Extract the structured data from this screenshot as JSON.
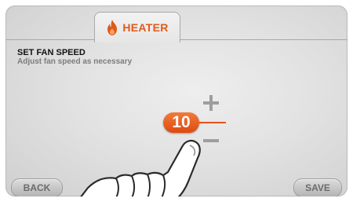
{
  "header": {
    "tab_label": "HEATER",
    "tab_icon": "flame-icon",
    "accent_color": "#e05a1a"
  },
  "main": {
    "title": "SET FAN SPEED",
    "subtitle": "Adjust fan speed as necessary",
    "fan_speed": "10",
    "increase_icon": "plus-icon",
    "decrease_icon": "minus-icon"
  },
  "footer": {
    "back_label": "BACK",
    "save_label": "SAVE"
  }
}
